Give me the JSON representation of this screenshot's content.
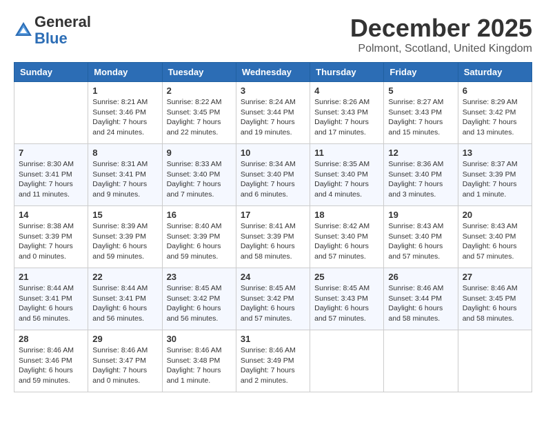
{
  "header": {
    "logo_general": "General",
    "logo_blue": "Blue",
    "month_title": "December 2025",
    "location": "Polmont, Scotland, United Kingdom"
  },
  "weekdays": [
    "Sunday",
    "Monday",
    "Tuesday",
    "Wednesday",
    "Thursday",
    "Friday",
    "Saturday"
  ],
  "weeks": [
    [
      {
        "day": "",
        "info": ""
      },
      {
        "day": "1",
        "info": "Sunrise: 8:21 AM\nSunset: 3:46 PM\nDaylight: 7 hours\nand 24 minutes."
      },
      {
        "day": "2",
        "info": "Sunrise: 8:22 AM\nSunset: 3:45 PM\nDaylight: 7 hours\nand 22 minutes."
      },
      {
        "day": "3",
        "info": "Sunrise: 8:24 AM\nSunset: 3:44 PM\nDaylight: 7 hours\nand 19 minutes."
      },
      {
        "day": "4",
        "info": "Sunrise: 8:26 AM\nSunset: 3:43 PM\nDaylight: 7 hours\nand 17 minutes."
      },
      {
        "day": "5",
        "info": "Sunrise: 8:27 AM\nSunset: 3:43 PM\nDaylight: 7 hours\nand 15 minutes."
      },
      {
        "day": "6",
        "info": "Sunrise: 8:29 AM\nSunset: 3:42 PM\nDaylight: 7 hours\nand 13 minutes."
      }
    ],
    [
      {
        "day": "7",
        "info": "Sunrise: 8:30 AM\nSunset: 3:41 PM\nDaylight: 7 hours\nand 11 minutes."
      },
      {
        "day": "8",
        "info": "Sunrise: 8:31 AM\nSunset: 3:41 PM\nDaylight: 7 hours\nand 9 minutes."
      },
      {
        "day": "9",
        "info": "Sunrise: 8:33 AM\nSunset: 3:40 PM\nDaylight: 7 hours\nand 7 minutes."
      },
      {
        "day": "10",
        "info": "Sunrise: 8:34 AM\nSunset: 3:40 PM\nDaylight: 7 hours\nand 6 minutes."
      },
      {
        "day": "11",
        "info": "Sunrise: 8:35 AM\nSunset: 3:40 PM\nDaylight: 7 hours\nand 4 minutes."
      },
      {
        "day": "12",
        "info": "Sunrise: 8:36 AM\nSunset: 3:40 PM\nDaylight: 7 hours\nand 3 minutes."
      },
      {
        "day": "13",
        "info": "Sunrise: 8:37 AM\nSunset: 3:39 PM\nDaylight: 7 hours\nand 1 minute."
      }
    ],
    [
      {
        "day": "14",
        "info": "Sunrise: 8:38 AM\nSunset: 3:39 PM\nDaylight: 7 hours\nand 0 minutes."
      },
      {
        "day": "15",
        "info": "Sunrise: 8:39 AM\nSunset: 3:39 PM\nDaylight: 6 hours\nand 59 minutes."
      },
      {
        "day": "16",
        "info": "Sunrise: 8:40 AM\nSunset: 3:39 PM\nDaylight: 6 hours\nand 59 minutes."
      },
      {
        "day": "17",
        "info": "Sunrise: 8:41 AM\nSunset: 3:39 PM\nDaylight: 6 hours\nand 58 minutes."
      },
      {
        "day": "18",
        "info": "Sunrise: 8:42 AM\nSunset: 3:40 PM\nDaylight: 6 hours\nand 57 minutes."
      },
      {
        "day": "19",
        "info": "Sunrise: 8:43 AM\nSunset: 3:40 PM\nDaylight: 6 hours\nand 57 minutes."
      },
      {
        "day": "20",
        "info": "Sunrise: 8:43 AM\nSunset: 3:40 PM\nDaylight: 6 hours\nand 57 minutes."
      }
    ],
    [
      {
        "day": "21",
        "info": "Sunrise: 8:44 AM\nSunset: 3:41 PM\nDaylight: 6 hours\nand 56 minutes."
      },
      {
        "day": "22",
        "info": "Sunrise: 8:44 AM\nSunset: 3:41 PM\nDaylight: 6 hours\nand 56 minutes."
      },
      {
        "day": "23",
        "info": "Sunrise: 8:45 AM\nSunset: 3:42 PM\nDaylight: 6 hours\nand 56 minutes."
      },
      {
        "day": "24",
        "info": "Sunrise: 8:45 AM\nSunset: 3:42 PM\nDaylight: 6 hours\nand 57 minutes."
      },
      {
        "day": "25",
        "info": "Sunrise: 8:45 AM\nSunset: 3:43 PM\nDaylight: 6 hours\nand 57 minutes."
      },
      {
        "day": "26",
        "info": "Sunrise: 8:46 AM\nSunset: 3:44 PM\nDaylight: 6 hours\nand 58 minutes."
      },
      {
        "day": "27",
        "info": "Sunrise: 8:46 AM\nSunset: 3:45 PM\nDaylight: 6 hours\nand 58 minutes."
      }
    ],
    [
      {
        "day": "28",
        "info": "Sunrise: 8:46 AM\nSunset: 3:46 PM\nDaylight: 6 hours\nand 59 minutes."
      },
      {
        "day": "29",
        "info": "Sunrise: 8:46 AM\nSunset: 3:47 PM\nDaylight: 7 hours\nand 0 minutes."
      },
      {
        "day": "30",
        "info": "Sunrise: 8:46 AM\nSunset: 3:48 PM\nDaylight: 7 hours\nand 1 minute."
      },
      {
        "day": "31",
        "info": "Sunrise: 8:46 AM\nSunset: 3:49 PM\nDaylight: 7 hours\nand 2 minutes."
      },
      {
        "day": "",
        "info": ""
      },
      {
        "day": "",
        "info": ""
      },
      {
        "day": "",
        "info": ""
      }
    ]
  ]
}
